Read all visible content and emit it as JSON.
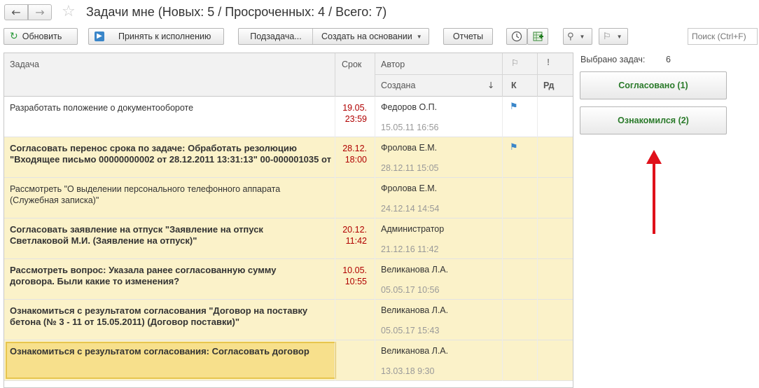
{
  "window": {
    "title": "Задачи мне (Новых: 5 / Просроченных: 4 / Всего: 7)",
    "back_icon": "←",
    "forward_icon": "→",
    "star_icon": "☆"
  },
  "toolbar": {
    "refresh_label": "Обновить",
    "accept_label": "Принять к исполнению",
    "subtask_label": "Подзадача...",
    "create_based_label": "Создать на основании",
    "reports_label": "Отчеты",
    "search_placeholder": "Поиск (Ctrl+F)"
  },
  "table": {
    "headers": {
      "task": "Задача",
      "due": "Срок",
      "author": "Автор",
      "created": "Создана",
      "sort_arrow": "↓",
      "k": "К",
      "rd": "Рд"
    },
    "rows": [
      {
        "task": "Разработать положение о документообороте",
        "bold": false,
        "due": "19.05.\n23:59",
        "author": "Федоров О.П.",
        "created": "15.05.11 16:56",
        "flag": true,
        "style": "white"
      },
      {
        "task": "Согласовать перенос срока по задаче: Обработать резолюцию\n\"Входящее письмо 00000000002 от 28.12.2011 13:31:13\" 00-000001035 от",
        "bold": true,
        "due": "28.12.\n18:00",
        "author": "Фролова Е.М.",
        "created": "28.12.11 15:05",
        "flag": true,
        "style": "yellow"
      },
      {
        "task": "Рассмотреть \"О выделении персонального телефонного аппарата\n(Служебная записка)\"",
        "bold": false,
        "due": "",
        "author": "Фролова Е.М.",
        "created": "24.12.14 14:54",
        "flag": false,
        "style": "yellow"
      },
      {
        "task": "Согласовать заявление на отпуск \"Заявление на отпуск\nСветлаковой М.И. (Заявление на отпуск)\"",
        "bold": true,
        "due": "20.12.\n11:42",
        "author": "Администратор",
        "created": "21.12.16 11:42",
        "flag": false,
        "style": "yellow"
      },
      {
        "task": "Рассмотреть вопрос: Указала ранее согласованную сумму\nдоговора. Были какие то изменения?",
        "bold": true,
        "due": "10.05.\n10:55",
        "author": "Великанова Л.А.",
        "created": "05.05.17 10:56",
        "flag": false,
        "style": "yellow"
      },
      {
        "task": "Ознакомиться с результатом согласования \"Договор на поставку\nбетона (№ 3 - 11 от 15.05.2011) (Договор поставки)\"",
        "bold": true,
        "due": "",
        "author": "Великанова Л.А.",
        "created": "05.05.17 15:43",
        "flag": false,
        "style": "yellow"
      },
      {
        "task": "Ознакомиться с результатом согласования: Согласовать договор",
        "bold": true,
        "due": "",
        "author": "Великанова Л.А.",
        "created": "13.03.18 9:30",
        "flag": false,
        "style": "yellow",
        "selected": true
      }
    ]
  },
  "panel": {
    "selected_label": "Выбрано задач:",
    "selected_count": "6",
    "approved_label": "Согласовано (1)",
    "acknowledged_label": "Ознакомился (2)"
  },
  "colors": {
    "row_highlight": "#fbf2c9",
    "selected_cell": "#f7e08c",
    "due_red": "#b00000",
    "button_green": "#2a7a2a",
    "arrow_red": "#e0101a"
  }
}
